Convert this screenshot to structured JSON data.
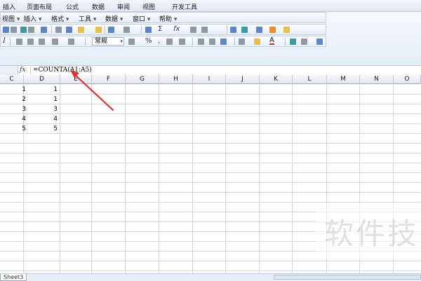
{
  "ribbon_tabs": [
    "插入",
    "页面布局",
    "公式",
    "数据",
    "审阅",
    "视图",
    "开发工具"
  ],
  "menu": [
    {
      "label": "视图",
      "arrow": "▾"
    },
    {
      "label": "插入",
      "arrow": "▾"
    },
    {
      "label": "格式",
      "arrow": "▾"
    },
    {
      "label": "工具",
      "arrow": "▾"
    },
    {
      "label": "数据",
      "arrow": "▾"
    },
    {
      "label": "窗口",
      "arrow": "▾"
    },
    {
      "label": "帮助",
      "arrow": "▾"
    }
  ],
  "toolbar": {
    "number_format": "常规",
    "percent": "%",
    "comma": ",",
    "sum": "Σ",
    "function": "fx",
    "bold_stub": "I",
    "font_color_label": "A"
  },
  "formula_bar": {
    "fx_label": "fx",
    "formula": "=COUNTA(A1:A5)"
  },
  "columns": [
    "C",
    "D",
    "E",
    "F",
    "G",
    "H",
    "I",
    "J",
    "K",
    "L",
    "M",
    "N",
    "O"
  ],
  "rows": [
    {
      "c": "1",
      "d": "1"
    },
    {
      "c": "2",
      "d": "1"
    },
    {
      "c": "3",
      "d": "3"
    },
    {
      "c": "4",
      "d": "4"
    },
    {
      "c": "5",
      "d": "5"
    }
  ],
  "sheet_tab": "Sheet3",
  "watermark": "软件技"
}
